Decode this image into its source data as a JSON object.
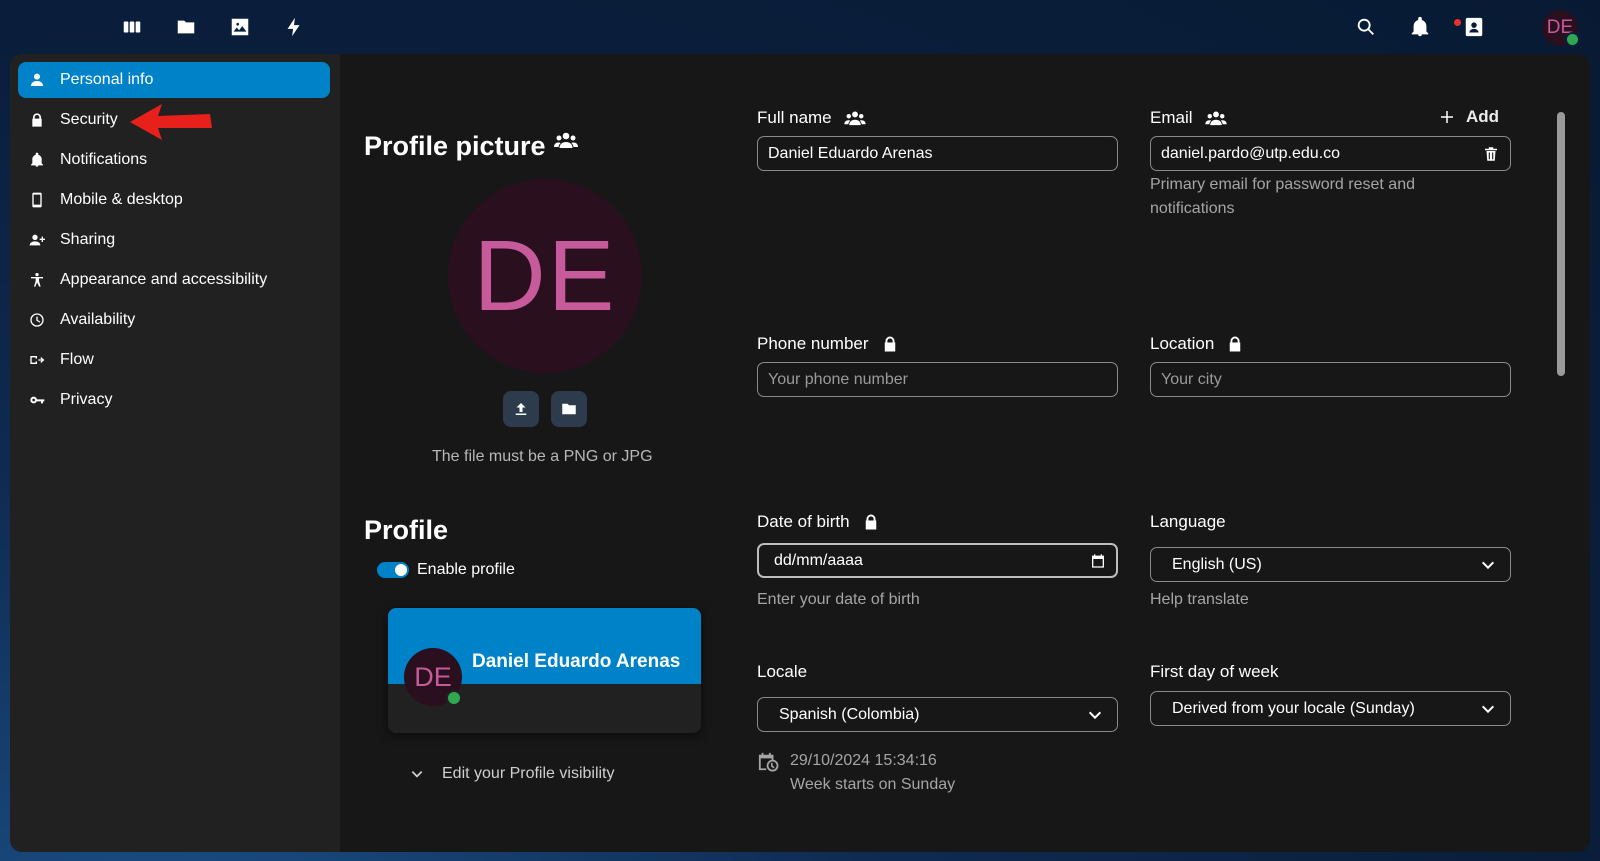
{
  "topbar": {
    "apps": [
      "dashboard-icon",
      "files-icon",
      "photos-icon",
      "activity-icon"
    ],
    "right": [
      "search-icon",
      "notifications-icon",
      "contacts-icon"
    ],
    "avatar_initials": "DE"
  },
  "sidebar": {
    "items": [
      {
        "label": "Personal info",
        "icon": "person-icon",
        "active": true
      },
      {
        "label": "Security",
        "icon": "lock-icon"
      },
      {
        "label": "Notifications",
        "icon": "bell-icon"
      },
      {
        "label": "Mobile & desktop",
        "icon": "phone-icon"
      },
      {
        "label": "Sharing",
        "icon": "share-person-icon"
      },
      {
        "label": "Appearance and accessibility",
        "icon": "accessibility-icon"
      },
      {
        "label": "Availability",
        "icon": "clock-icon"
      },
      {
        "label": "Flow",
        "icon": "flow-icon"
      },
      {
        "label": "Privacy",
        "icon": "key-icon"
      }
    ]
  },
  "profile_picture": {
    "title": "Profile picture",
    "initials": "DE",
    "hint": "The file must be a PNG or JPG"
  },
  "profile": {
    "title": "Profile",
    "enable_label": "Enable profile",
    "enabled": true,
    "card_name": "Daniel Eduardo Arenas",
    "card_initials": "DE",
    "visibility_label": "Edit your Profile visibility"
  },
  "fields": {
    "fullname": {
      "label": "Full name",
      "value": "Daniel Eduardo Arenas"
    },
    "email": {
      "label": "Email",
      "add_label": "Add",
      "value": "daniel.pardo@utp.edu.co",
      "hint": "Primary email for password reset and notifications"
    },
    "phone": {
      "label": "Phone number",
      "placeholder": "Your phone number"
    },
    "location": {
      "label": "Location",
      "placeholder": "Your city"
    },
    "birth": {
      "label": "Date of birth",
      "value": "dd/mm/aaaa",
      "hint": "Enter your date of birth"
    },
    "language": {
      "label": "Language",
      "value": "English (US)",
      "hint": "Help translate"
    },
    "locale": {
      "label": "Locale",
      "value": "Spanish (Colombia)",
      "time": "29/10/2024 15:34:16",
      "week": "Week starts on Sunday"
    },
    "firstday": {
      "label": "First day of week",
      "value": "Derived from your locale (Sunday)"
    }
  },
  "colors": {
    "accent": "#0082c9",
    "avatar_text": "#c65a9a",
    "online": "#2fa84f",
    "annotation_arrow": "#e8201c"
  }
}
